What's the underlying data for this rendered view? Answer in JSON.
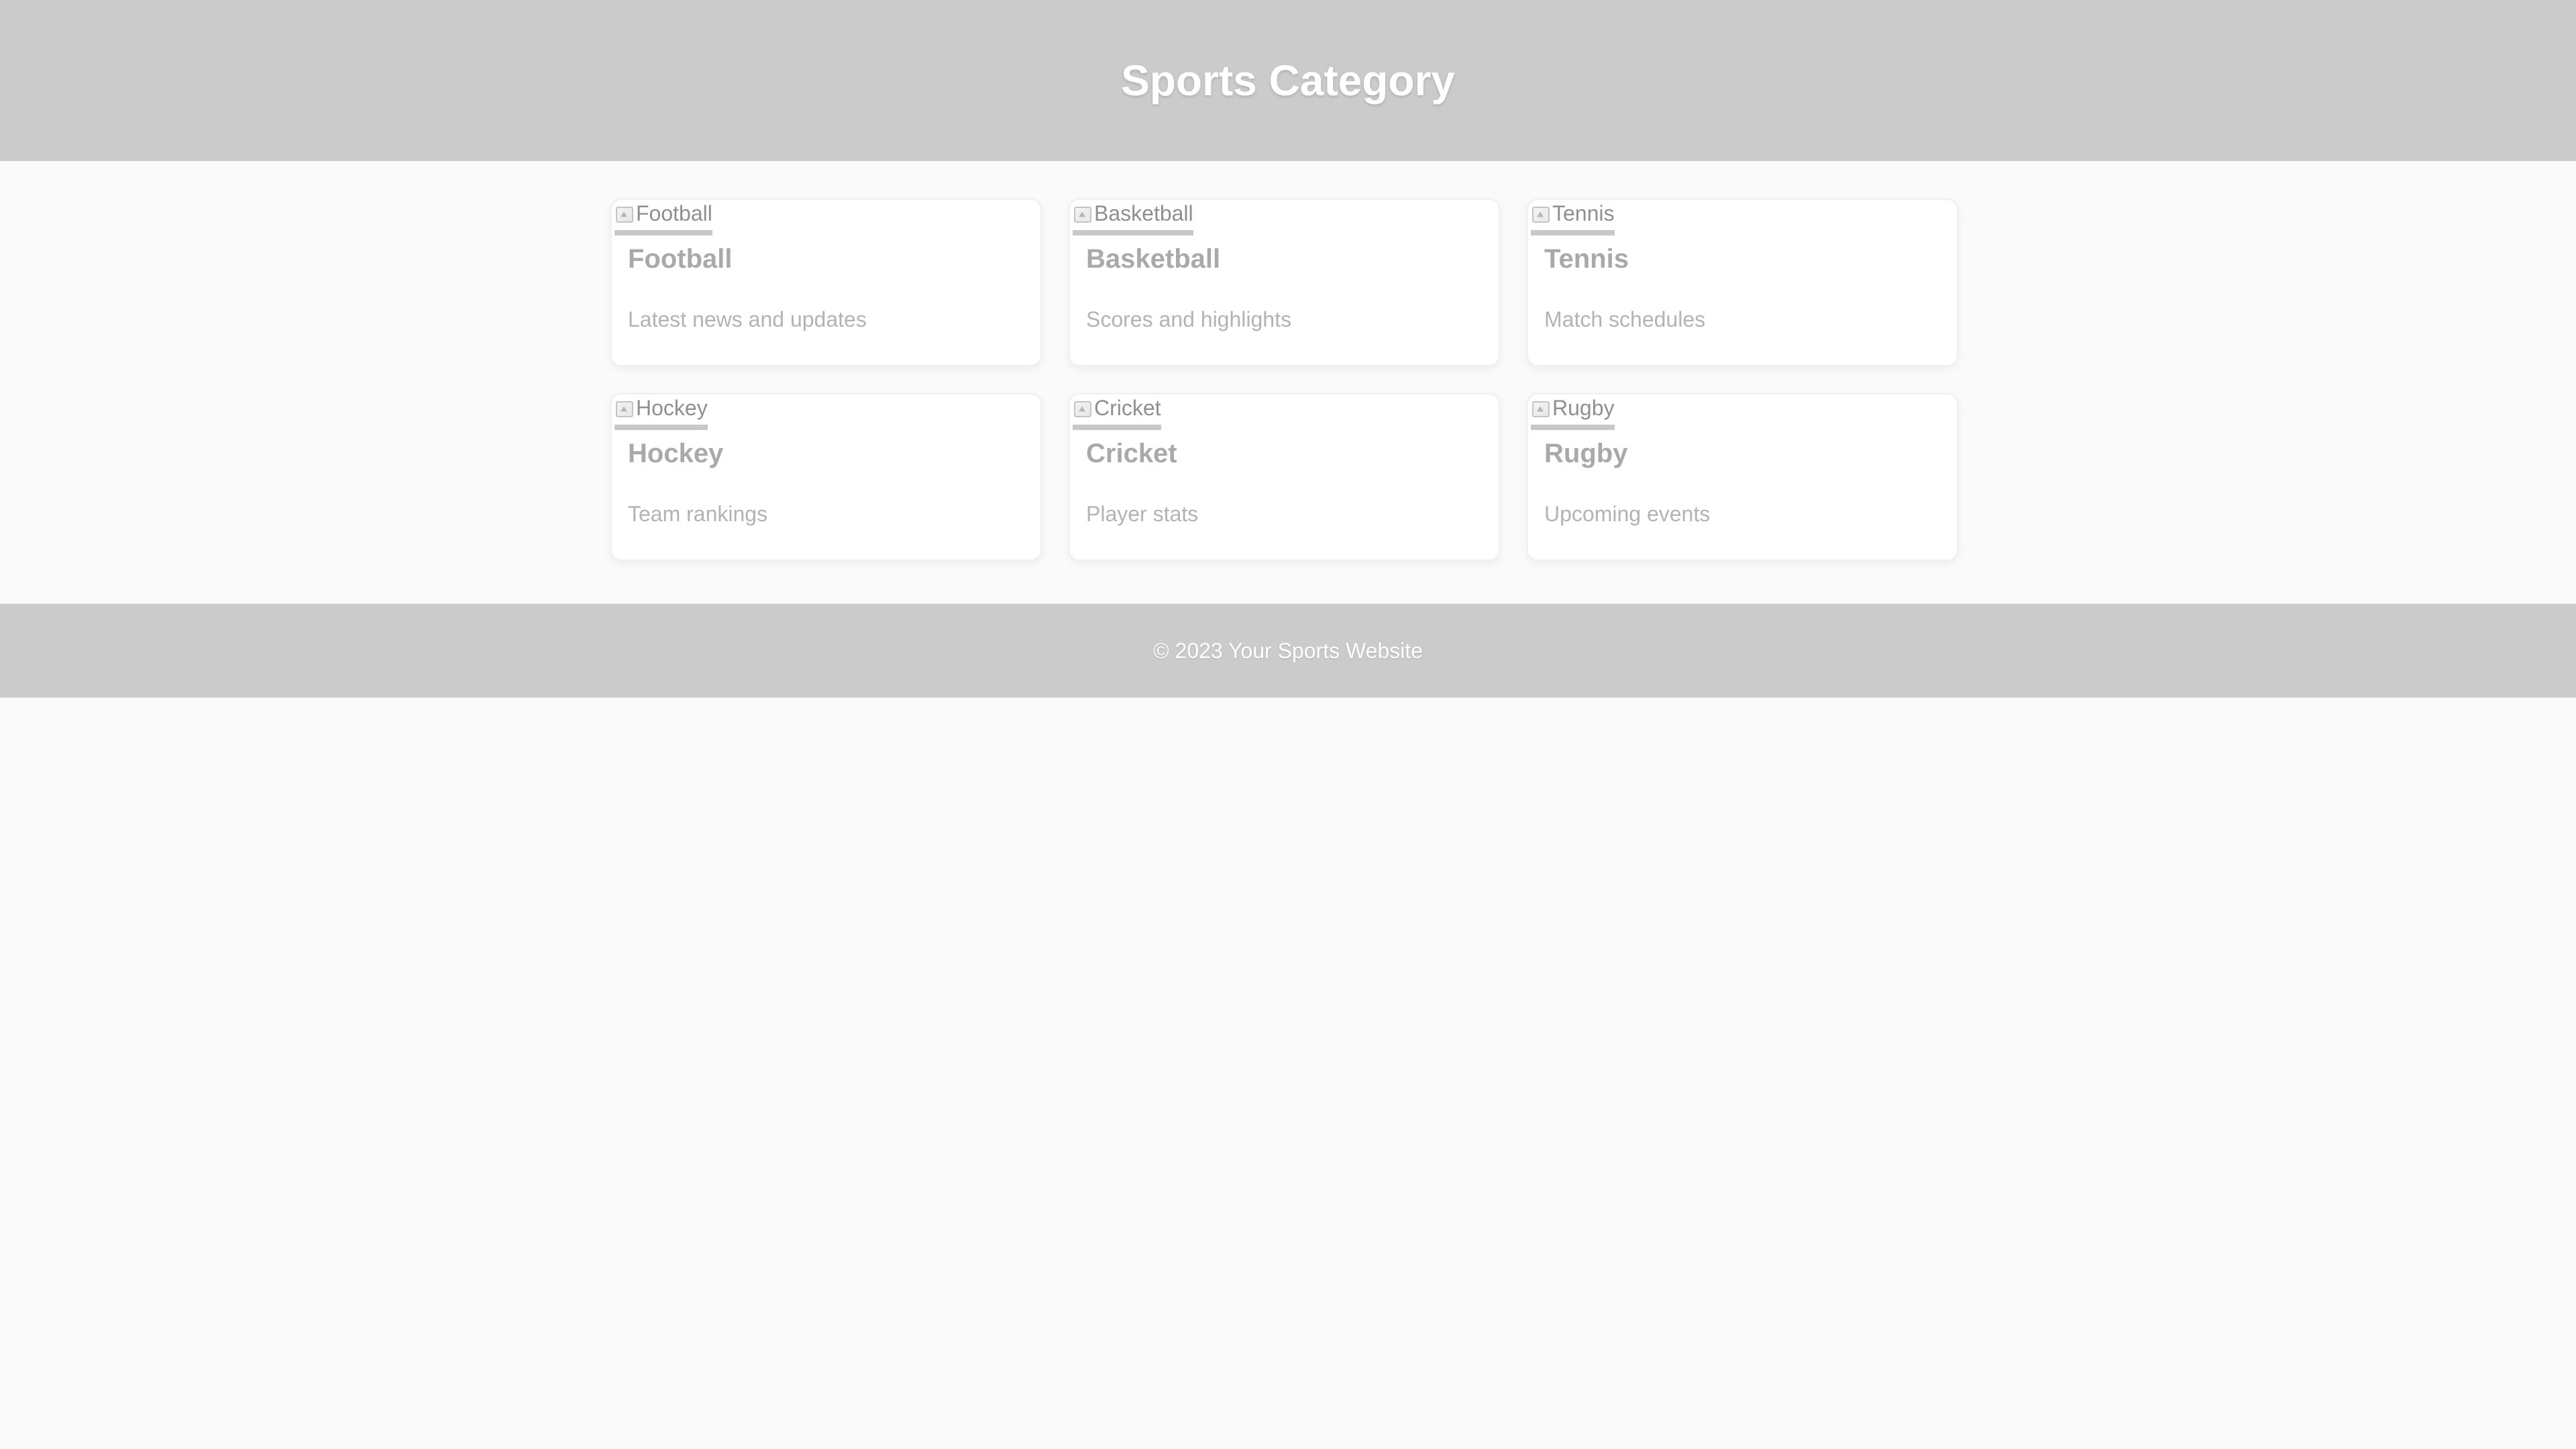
{
  "header": {
    "title": "Sports Category"
  },
  "cards": [
    {
      "image_alt": "Football",
      "title": "Football",
      "description": "Latest news and updates"
    },
    {
      "image_alt": "Basketball",
      "title": "Basketball",
      "description": "Scores and highlights"
    },
    {
      "image_alt": "Tennis",
      "title": "Tennis",
      "description": "Match schedules"
    },
    {
      "image_alt": "Hockey",
      "title": "Hockey",
      "description": "Team rankings"
    },
    {
      "image_alt": "Cricket",
      "title": "Cricket",
      "description": "Player stats"
    },
    {
      "image_alt": "Rugby",
      "title": "Rugby",
      "description": "Upcoming events"
    }
  ],
  "footer": {
    "copyright": "© 2023 Your Sports Website"
  },
  "colors": {
    "header_bg": "#cbcbcb",
    "footer_bg": "#cbcbcb",
    "page_bg": "#fafafa",
    "card_bg": "#ffffff"
  },
  "icons": {
    "card_image": "broken-image-icon"
  }
}
